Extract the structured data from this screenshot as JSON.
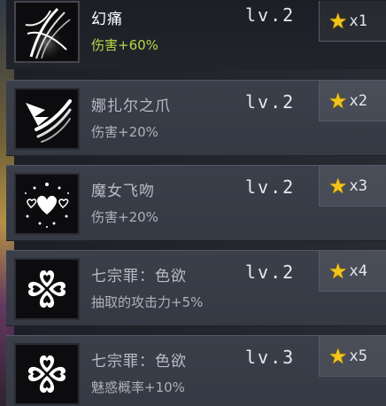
{
  "skills": [
    {
      "name": "幻痛",
      "effect": "伤害+60%",
      "level": "lv.2",
      "count": "x1",
      "icon": "phantom-pain-icon",
      "selected": true
    },
    {
      "name": "娜扎尔之爪",
      "effect": "伤害+20%",
      "level": "lv.2",
      "count": "x2",
      "icon": "claw-slash-icon",
      "selected": false
    },
    {
      "name": "魔女飞吻",
      "effect": "伤害+20%",
      "level": "lv.2",
      "count": "x3",
      "icon": "hearts-kiss-icon",
      "selected": false
    },
    {
      "name": "七宗罪：色欲",
      "effect": "抽取的攻击力+5%",
      "level": "lv.2",
      "count": "x4",
      "icon": "heart-clover-icon",
      "selected": false
    },
    {
      "name": "七宗罪：色欲",
      "effect": "魅惑概率+10%",
      "level": "lv.3",
      "count": "x5",
      "icon": "heart-clover-icon",
      "selected": false
    }
  ],
  "colors": {
    "star": "#f3c51a",
    "selected_effect": "#b6d84a"
  }
}
